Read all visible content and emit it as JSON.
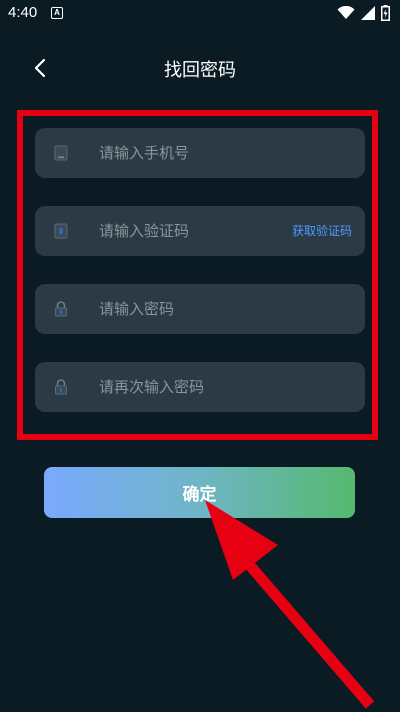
{
  "status_bar": {
    "time": "4:40",
    "notification_icon_letter": "A"
  },
  "header": {
    "title": "找回密码"
  },
  "form": {
    "phone": {
      "placeholder": "请输入手机号",
      "icon": "phone-icon"
    },
    "verification_code": {
      "placeholder": "请输入验证码",
      "icon": "shield-icon",
      "action_label": "获取验证码"
    },
    "password": {
      "placeholder": "请输入密码",
      "icon": "lock-icon"
    },
    "confirm_password": {
      "placeholder": "请再次输入密码",
      "icon": "lock-icon"
    }
  },
  "confirm_button": {
    "label": "确定"
  },
  "colors": {
    "background": "#0b1b24",
    "field_background": "#2b3a44",
    "link": "#4e9bff",
    "annotation_red": "#e60012",
    "button_gradient_start": "#7aa9ff",
    "button_gradient_end": "#55b96e"
  }
}
